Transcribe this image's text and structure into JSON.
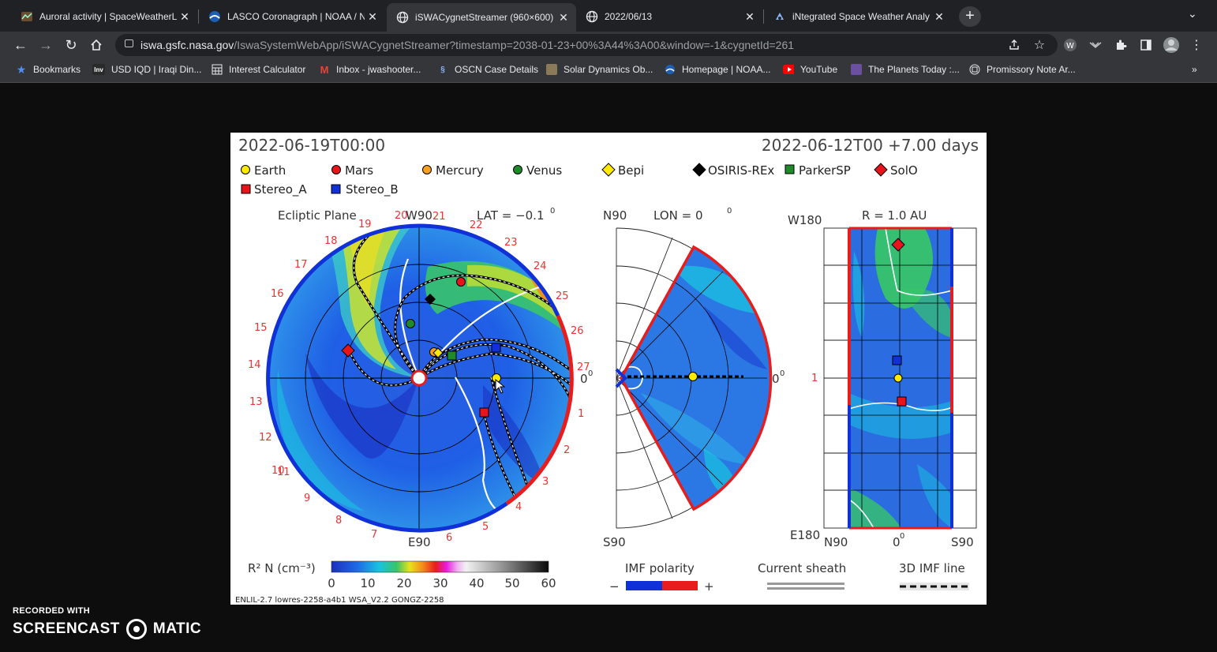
{
  "tabs": [
    {
      "title": "Auroral activity | SpaceWeatherL",
      "icon": "aurora-icon",
      "active": false
    },
    {
      "title": "LASCO Coronagraph | NOAA / N",
      "icon": "noaa-icon",
      "active": false
    },
    {
      "title": "iSWACygnetStreamer (960×600)",
      "icon": "globe-icon",
      "active": true
    },
    {
      "title": "2022/06/13",
      "icon": "globe-icon",
      "active": false
    },
    {
      "title": "iNtegrated Space Weather Analy",
      "icon": "iswa-icon",
      "active": false
    }
  ],
  "address": {
    "domain": "iswa.gsfc.nasa.gov",
    "path": "/IswaSystemWebApp/iSWACygnetStreamer?timestamp=2038-01-23+00%3A44%3A00&window=-1&cygnetId=261"
  },
  "bookmarks": [
    {
      "label": "Bookmarks",
      "icon": "star-icon"
    },
    {
      "label": "USD IQD | Iraqi Din...",
      "icon": "inv-icon"
    },
    {
      "label": "Interest Calculator",
      "icon": "calculator-icon"
    },
    {
      "label": "Inbox - jwashooter...",
      "icon": "gmail-icon"
    },
    {
      "label": "OSCN Case Details",
      "icon": "oscn-icon"
    },
    {
      "label": "Solar Dynamics Ob...",
      "icon": "sdo-icon"
    },
    {
      "label": "Homepage | NOAA...",
      "icon": "noaa-icon"
    },
    {
      "label": "YouTube",
      "icon": "youtube-icon"
    },
    {
      "label": "The Planets Today :...",
      "icon": "planets-icon"
    },
    {
      "label": "Promissory Note Ar...",
      "icon": "document-icon"
    }
  ],
  "viz": {
    "timestamp_left": "2022-06-19T00:00",
    "timestamp_right": "2022-06-12T00 +7.00 days",
    "legend": [
      {
        "name": "Earth",
        "shape": "circle",
        "color": "#ffeb00"
      },
      {
        "name": "Mars",
        "shape": "circle",
        "color": "#e8141c"
      },
      {
        "name": "Mercury",
        "shape": "circle",
        "color": "#f5a020"
      },
      {
        "name": "Venus",
        "shape": "circle",
        "color": "#1e8a2a"
      },
      {
        "name": "Bepi",
        "shape": "diamond",
        "color": "#ffeb00"
      },
      {
        "name": "OSIRIS-REx",
        "shape": "diamond",
        "color": "#000000"
      },
      {
        "name": "ParkerSP",
        "shape": "square",
        "color": "#1e8a2a"
      },
      {
        "name": "SolO",
        "shape": "diamond",
        "color": "#e8141c"
      },
      {
        "name": "Stereo_A",
        "shape": "square",
        "color": "#e8141c"
      },
      {
        "name": "Stereo_B",
        "shape": "square",
        "color": "#1030d8"
      }
    ],
    "ecliptic_title": "Ecliptic Plane",
    "w90": "W90",
    "e90": "E90",
    "lat_label": "LAT = −0.1",
    "degree": "0",
    "zero_label": "0",
    "carrington": [
      "1",
      "2",
      "3",
      "4",
      "5",
      "6",
      "7",
      "8",
      "9",
      "10",
      "11",
      "12",
      "13",
      "14",
      "15",
      "16",
      "17",
      "18",
      "19",
      "20",
      "21",
      "22",
      "23",
      "24",
      "25",
      "26",
      "27"
    ],
    "meridional": {
      "n90": "N90",
      "s90": "S90",
      "lon_label": "LON = 0",
      "zero": "0"
    },
    "radial": {
      "w180": "W180",
      "e180": "E180",
      "r_label": "R = 1.0 AU",
      "one": "1",
      "n90": "N90",
      "zero": "0",
      "s90": "S90"
    },
    "colorbar": {
      "label": "R² N (cm⁻³)",
      "ticks": [
        "0",
        "10",
        "20",
        "30",
        "40",
        "50",
        "60"
      ]
    },
    "imf": {
      "label": "IMF polarity",
      "minus": "−",
      "plus": "+"
    },
    "sheath_label": "Current sheath",
    "imf_line_label": "3D IMF line",
    "footer": "ENLIL-2.7 lowres-2258-a4b1 WSA_V2.2 GONGZ-2258"
  },
  "watermark": {
    "line1": "RECORDED WITH",
    "left": "SCREENCAST",
    "right": "MATIC"
  }
}
